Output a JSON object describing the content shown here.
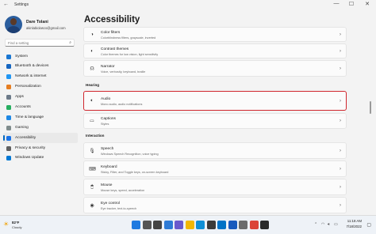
{
  "window": {
    "title": "Settings",
    "back_glyph": "←",
    "controls": [
      "—",
      "☐",
      "✕"
    ]
  },
  "profile": {
    "name": "Dare Tolani",
    "email": "akinlabiolasco@gmail.com"
  },
  "search": {
    "placeholder": "Find a setting",
    "icon": "search-icon"
  },
  "nav": [
    {
      "label": "System",
      "icon": "monitor-icon",
      "color": "#1976d2"
    },
    {
      "label": "Bluetooth & devices",
      "icon": "bluetooth-icon",
      "color": "#1565c0"
    },
    {
      "label": "Network & internet",
      "icon": "wifi-icon",
      "color": "#2196f3"
    },
    {
      "label": "Personalization",
      "icon": "brush-icon",
      "color": "#e67e22"
    },
    {
      "label": "Apps",
      "icon": "apps-icon",
      "color": "#6c7a89"
    },
    {
      "label": "Accounts",
      "icon": "person-icon",
      "color": "#27ae60"
    },
    {
      "label": "Time & language",
      "icon": "globe-clock-icon",
      "color": "#1e88e5"
    },
    {
      "label": "Gaming",
      "icon": "controller-icon",
      "color": "#7f8c8d"
    },
    {
      "label": "Accessibility",
      "icon": "accessibility-icon",
      "color": "#1a73e8"
    },
    {
      "label": "Privacy & security",
      "icon": "shield-icon",
      "color": "#616161"
    },
    {
      "label": "Windows Update",
      "icon": "update-icon",
      "color": "#0078d4"
    }
  ],
  "active_nav": "Accessibility",
  "page": {
    "title": "Accessibility"
  },
  "cards_top": [
    {
      "title": "Color filters",
      "desc": "Colorblindness filters, grayscale, inverted",
      "icon": "color-filter-icon"
    },
    {
      "title": "Contrast themes",
      "desc": "Color themes for low vision, light sensitivity",
      "icon": "contrast-icon"
    },
    {
      "title": "Narrator",
      "desc": "Voice, verbosity, keyboard, braille",
      "icon": "narrator-icon"
    }
  ],
  "sections": {
    "hearing": "Hearing",
    "interaction": "Interaction"
  },
  "cards_hearing": [
    {
      "title": "Audio",
      "desc": "Mono audio, audio notifications",
      "icon": "speaker-icon"
    },
    {
      "title": "Captions",
      "desc": "Styles",
      "icon": "captions-icon"
    }
  ],
  "cards_interaction": [
    {
      "title": "Speech",
      "desc": "Windows Speech Recognition, voice typing",
      "icon": "microphone-icon"
    },
    {
      "title": "Keyboard",
      "desc": "Sticky, Filter, and Toggle keys, on-screen keyboard",
      "icon": "keyboard-icon"
    },
    {
      "title": "Mouse",
      "desc": "Mouse keys, speed, acceleration",
      "icon": "mouse-icon"
    },
    {
      "title": "Eye control",
      "desc": "Eye tracker, text-to-speech",
      "icon": "eye-icon"
    }
  ],
  "taskbar": {
    "weather_temp": "82°F",
    "weather_cond": "Cloudy",
    "time": "11:18 AM",
    "date": "7/18/2022",
    "apps": [
      {
        "icon": "start-icon",
        "color": "#1f7ae0"
      },
      {
        "icon": "search-icon",
        "color": "#555555"
      },
      {
        "icon": "task-view-icon",
        "color": "#444444"
      },
      {
        "icon": "widgets-icon",
        "color": "#2e7bd6"
      },
      {
        "icon": "chat-icon",
        "color": "#6a5acd"
      },
      {
        "icon": "file-explorer-icon",
        "color": "#f2b705"
      },
      {
        "icon": "edge-icon",
        "color": "#0f8fd6"
      },
      {
        "icon": "store-icon",
        "color": "#3b3b3b"
      },
      {
        "icon": "mail-icon",
        "color": "#0072c6"
      },
      {
        "icon": "word-icon",
        "color": "#185abd"
      },
      {
        "icon": "settings-icon",
        "color": "#6b6b6b"
      },
      {
        "icon": "chrome-icon",
        "color": "#db4437"
      },
      {
        "icon": "app-icon",
        "color": "#2a2a2a"
      }
    ]
  },
  "highlight_color": "#d0262d",
  "accent_color": "#0067c0"
}
